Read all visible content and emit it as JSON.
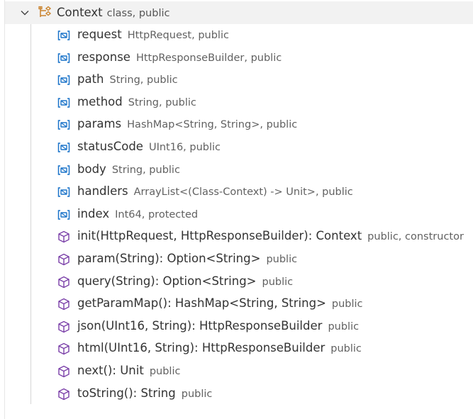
{
  "outline": {
    "class": {
      "name": "Context",
      "detail": "class, public",
      "icon": "class-icon",
      "expand_icon": "chevron-down-icon"
    },
    "members": [
      {
        "label": "request",
        "detail": "HttpRequest, public",
        "kind": "field"
      },
      {
        "label": "response",
        "detail": "HttpResponseBuilder, public",
        "kind": "field"
      },
      {
        "label": "path",
        "detail": "String, public",
        "kind": "field"
      },
      {
        "label": "method",
        "detail": "String, public",
        "kind": "field"
      },
      {
        "label": "params",
        "detail": "HashMap<String, String>, public",
        "kind": "field"
      },
      {
        "label": "statusCode",
        "detail": "UInt16, public",
        "kind": "field"
      },
      {
        "label": "body",
        "detail": "String, public",
        "kind": "field"
      },
      {
        "label": "handlers",
        "detail": "ArrayList<(Class-Context) -> Unit>, public",
        "kind": "field"
      },
      {
        "label": "index",
        "detail": "Int64, protected",
        "kind": "field"
      },
      {
        "label": "init(HttpRequest, HttpResponseBuilder): Context",
        "detail": "public, constructor",
        "kind": "method"
      },
      {
        "label": "param(String): Option<String>",
        "detail": "public",
        "kind": "method"
      },
      {
        "label": "query(String): Option<String>",
        "detail": "public",
        "kind": "method"
      },
      {
        "label": "getParamMap(): HashMap<String, String>",
        "detail": "public",
        "kind": "method"
      },
      {
        "label": "json(UInt16, String): HttpResponseBuilder",
        "detail": "public",
        "kind": "method"
      },
      {
        "label": "html(UInt16, String): HttpResponseBuilder",
        "detail": "public",
        "kind": "method"
      },
      {
        "label": "next(): Unit",
        "detail": "public",
        "kind": "method"
      },
      {
        "label": "toString(): String",
        "detail": "public",
        "kind": "method"
      }
    ]
  },
  "colors": {
    "field_icon": "#1a73c9",
    "method_icon": "#7a3fa8",
    "class_icon": "#c9822c",
    "header_bg": "#f2f2f2",
    "text": "#333333",
    "detail": "#616161"
  }
}
